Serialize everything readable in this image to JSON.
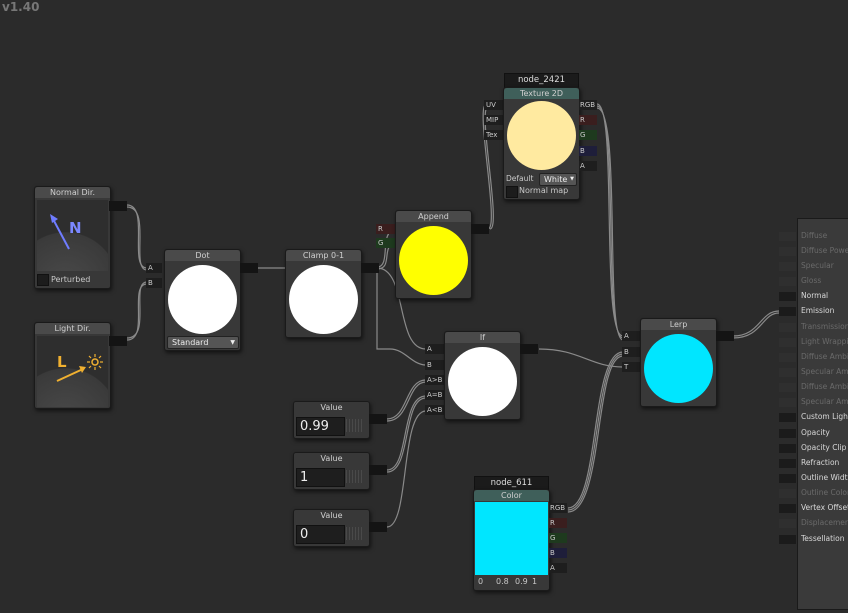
{
  "version": "v1.40",
  "colors": {
    "node_bg": "#383838",
    "wire": "#8a8a8a",
    "yellow": "#ffff00",
    "cream": "#ffeaa0",
    "cyan": "#00e6ff",
    "white": "#ffffff"
  },
  "normal_dir": {
    "title": "Normal Dir.",
    "letter": "N",
    "perturbed_label": "Perturbed"
  },
  "light_dir": {
    "title": "Light Dir.",
    "letter": "L"
  },
  "dot": {
    "title": "Dot",
    "in_a": "A",
    "in_b": "B",
    "mode": "Standard"
  },
  "clamp": {
    "title": "Clamp 0-1"
  },
  "append": {
    "title": "Append",
    "in_r": "R",
    "in_g": "G"
  },
  "texture": {
    "name": "node_2421",
    "title": "Texture 2D",
    "in_uv": "UV",
    "in_mip": "MIP",
    "in_tex": "Tex",
    "out_rgb": "RGB",
    "out_r": "R",
    "out_g": "G",
    "out_b": "B",
    "out_a": "A",
    "default_label": "Default",
    "default_value": "White",
    "normal_map_label": "Normal map"
  },
  "if_node": {
    "title": "If",
    "in_a": "A",
    "in_b": "B",
    "in_agtb": "A>B",
    "in_aeqb": "A=B",
    "in_altb": "A<B"
  },
  "values": [
    {
      "title": "Value",
      "value": "0.99"
    },
    {
      "title": "Value",
      "value": "1"
    },
    {
      "title": "Value",
      "value": "0"
    }
  ],
  "color": {
    "name": "node_611",
    "title": "Color",
    "out_rgb": "RGB",
    "out_r": "R",
    "out_g": "G",
    "out_b": "B",
    "out_a": "A",
    "r": "0",
    "g": "0.8",
    "b": "0.9",
    "a": "1"
  },
  "lerp": {
    "title": "Lerp",
    "in_a": "A",
    "in_b": "B",
    "in_t": "T"
  },
  "outputs": [
    {
      "label": "Diffuse",
      "active": false
    },
    {
      "label": "Diffuse Power",
      "active": false
    },
    {
      "label": "Specular",
      "active": false
    },
    {
      "label": "Gloss",
      "active": false
    },
    {
      "label": "Normal",
      "active": true
    },
    {
      "label": "Emission",
      "active": true
    },
    {
      "label": "Transmission",
      "active": false
    },
    {
      "label": "Light Wrapping",
      "active": false
    },
    {
      "label": "Diffuse Ambient Light",
      "active": false
    },
    {
      "label": "Specular Ambient Light",
      "active": false
    },
    {
      "label": "Diffuse Ambient Occlusion",
      "active": false
    },
    {
      "label": "Specular Ambient Occlusion",
      "active": false
    },
    {
      "label": "Custom Lighting",
      "active": true
    },
    {
      "label": "Opacity",
      "active": true
    },
    {
      "label": "Opacity Clip",
      "active": true
    },
    {
      "label": "Refraction",
      "active": true
    },
    {
      "label": "Outline Width",
      "active": true
    },
    {
      "label": "Outline Color",
      "active": false
    },
    {
      "label": "Vertex Offset",
      "active": true
    },
    {
      "label": "Displacement",
      "active": false
    },
    {
      "label": "Tessellation",
      "active": true
    }
  ]
}
